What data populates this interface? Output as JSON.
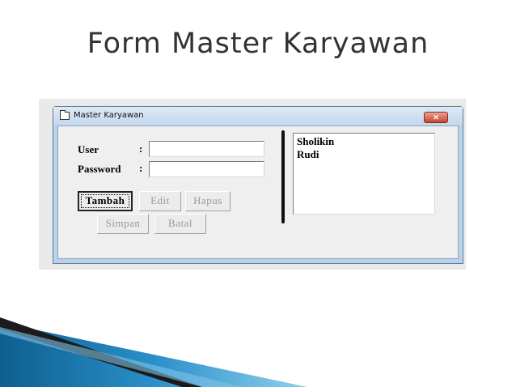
{
  "slide": {
    "title": "Form Master Karyawan"
  },
  "window": {
    "title": "Master Karyawan",
    "close_label": "✕"
  },
  "form": {
    "user_label": "User",
    "password_label": "Password",
    "colon": ":",
    "user_value": "",
    "password_value": ""
  },
  "buttons": {
    "tambah": "Tambah",
    "edit": "Edit",
    "hapus": "Hapus",
    "simpan": "Simpan",
    "batal": "Batal"
  },
  "list": {
    "items": [
      "Sholikin",
      "Rudi"
    ]
  },
  "colors": {
    "accent_dark": "#1b1b1b",
    "accent_blue": "#2a8fc9",
    "title_text": "#333333"
  }
}
